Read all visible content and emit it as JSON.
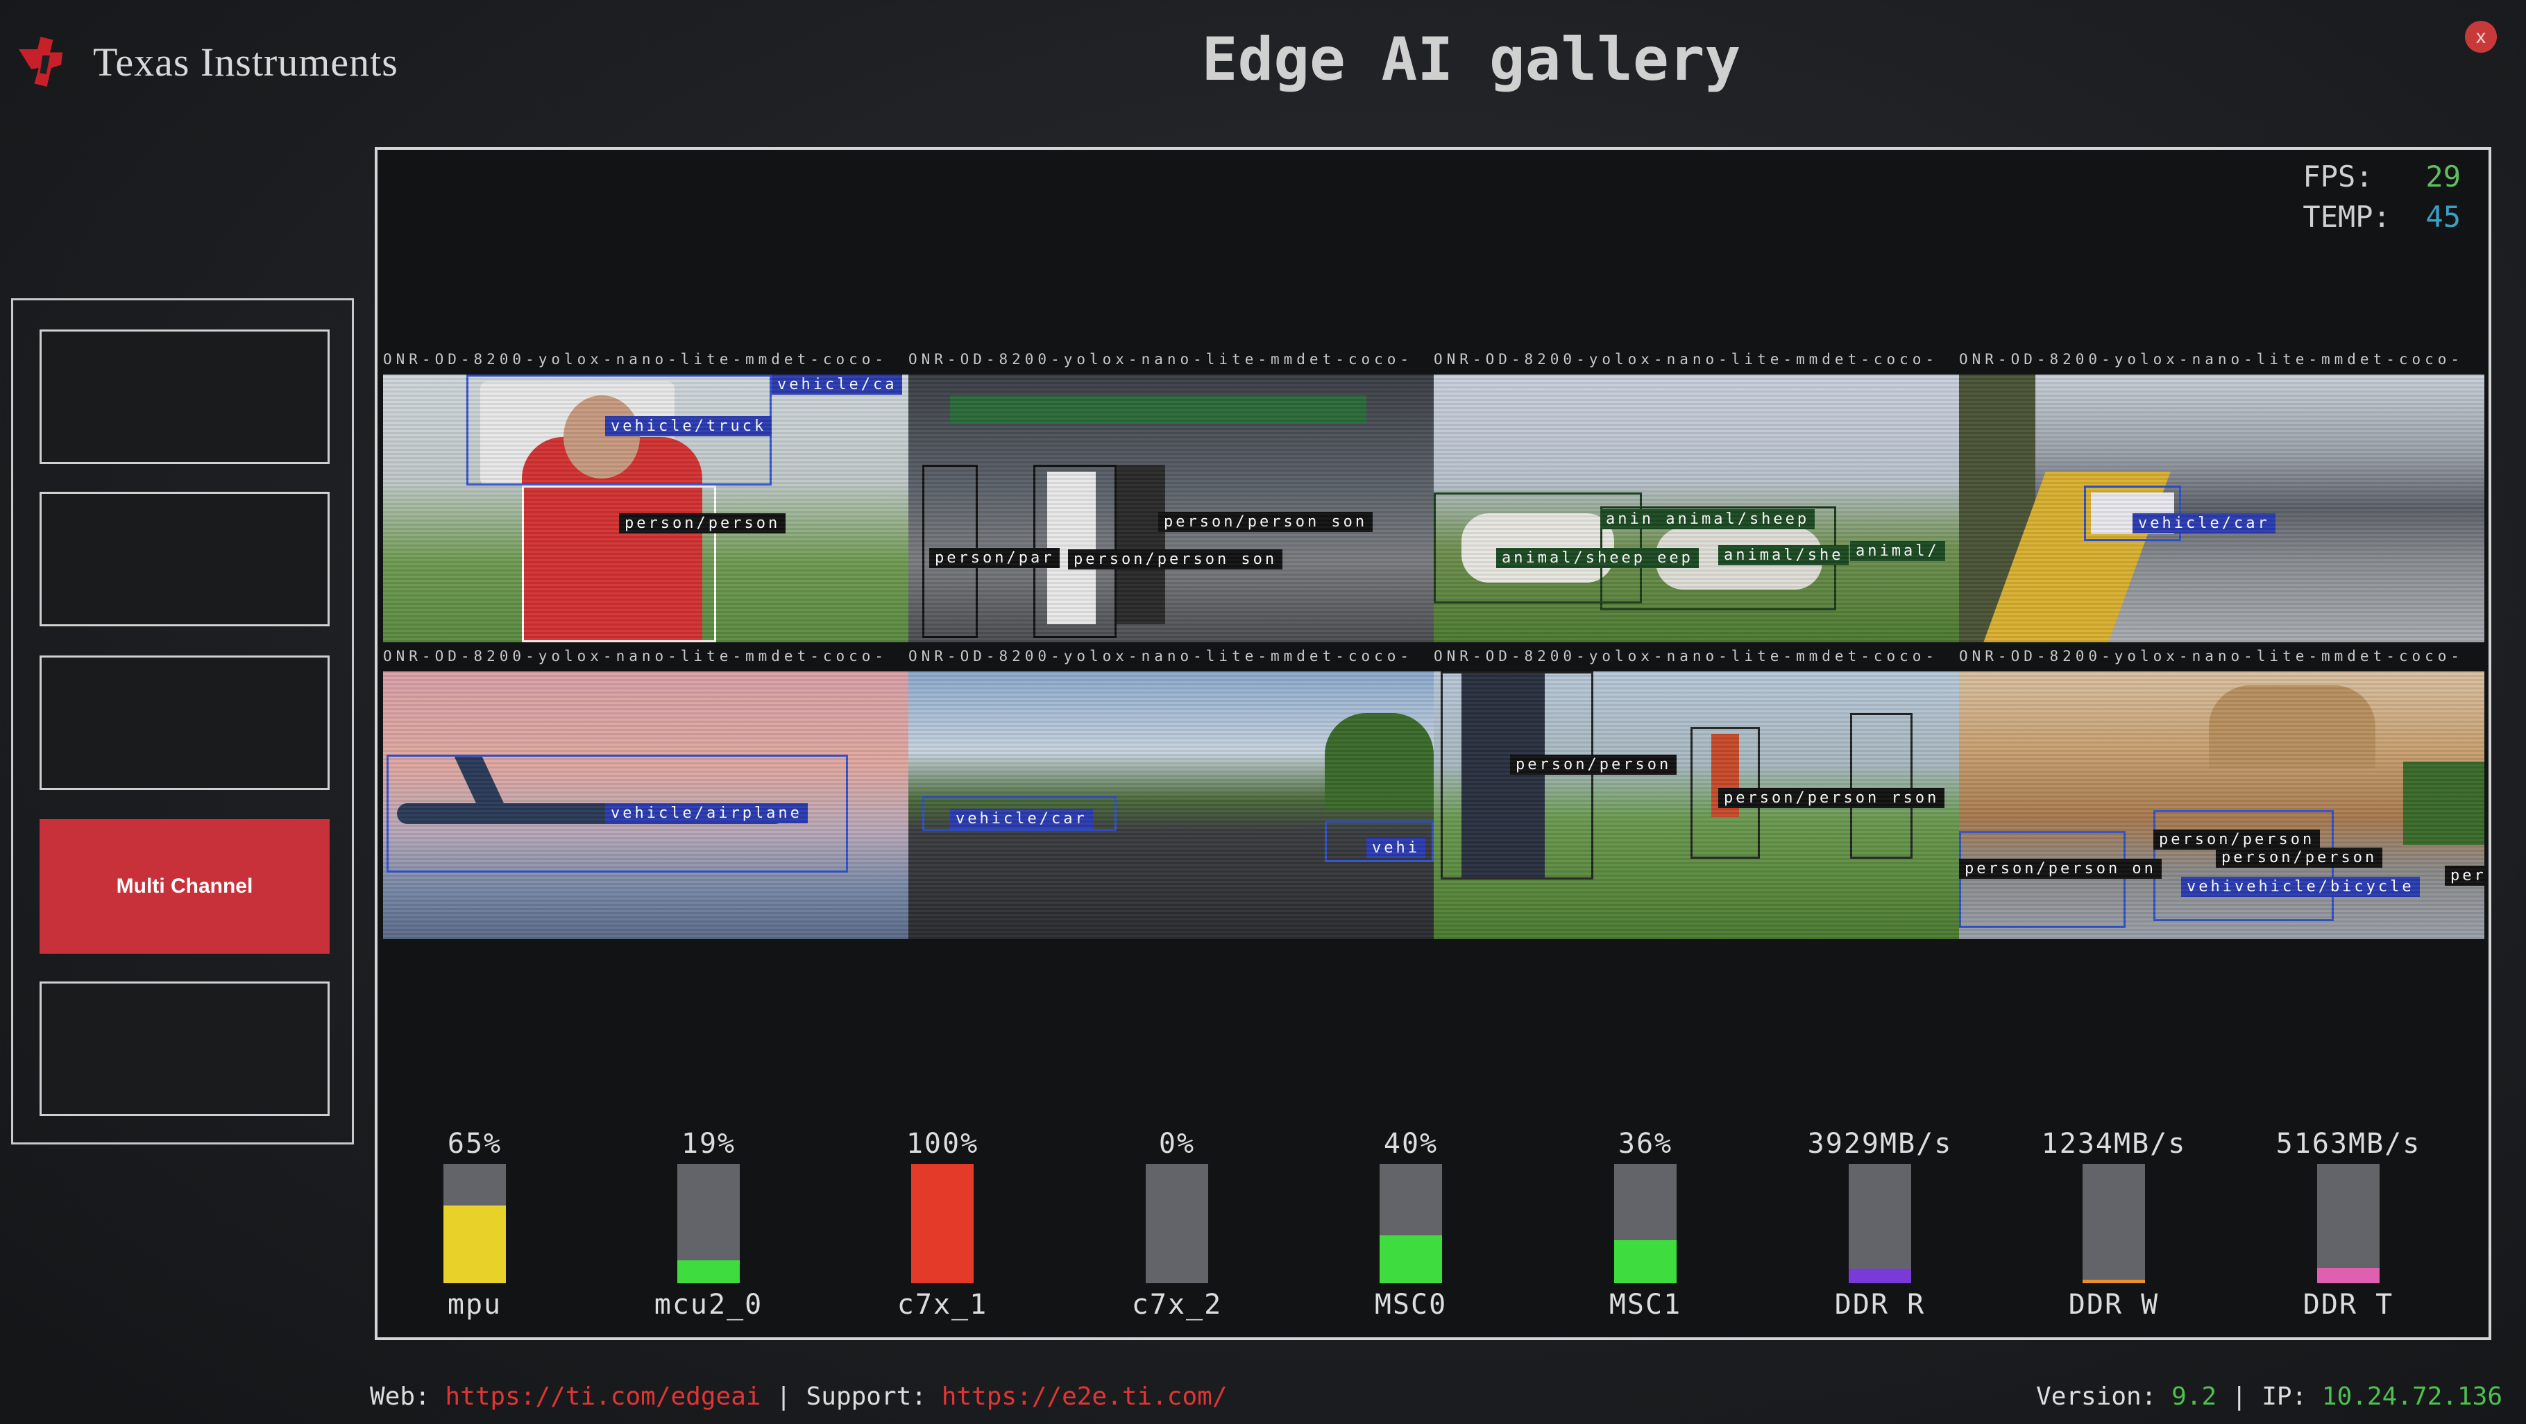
{
  "brand": {
    "name": "Texas Instruments",
    "icon": "ti-logo-icon"
  },
  "title": "Edge AI gallery",
  "close_label": "x",
  "sidebar": {
    "buttons": [
      {
        "label": ""
      },
      {
        "label": ""
      },
      {
        "label": ""
      },
      {
        "label": "Multi Channel",
        "active": true
      },
      {
        "label": ""
      }
    ]
  },
  "stats": {
    "fps_label": "FPS:",
    "fps": "29",
    "temp_label": "TEMP:",
    "temp": "45"
  },
  "channels": [
    {
      "caption": "ONR-OD-8200-yolox-nano-lite-mmdet-coco-",
      "labels": [
        "vehicle/ca",
        "vehicle/truck",
        "person/person"
      ]
    },
    {
      "caption": "ONR-OD-8200-yolox-nano-lite-mmdet-coco-",
      "labels": [
        "person/person son",
        "person/par",
        "person/person son"
      ]
    },
    {
      "caption": "ONR-OD-8200-yolox-nano-lite-mmdet-coco-",
      "labels": [
        "anin animal/sheep",
        "animal/sheep eep",
        "animal/she",
        "animal/"
      ]
    },
    {
      "caption": "ONR-OD-8200-yolox-nano-lite-mmdet-coco-",
      "labels": [
        "vehicle/car"
      ]
    },
    {
      "caption": "ONR-OD-8200-yolox-nano-lite-mmdet-coco-",
      "labels": [
        "vehicle/airplane"
      ]
    },
    {
      "caption": "ONR-OD-8200-yolox-nano-lite-mmdet-coco-",
      "labels": [
        "vehicle/car",
        "vehi"
      ]
    },
    {
      "caption": "ONR-OD-8200-yolox-nano-lite-mmdet-coco-",
      "labels": [
        "person/person",
        "person/person rson"
      ]
    },
    {
      "caption": "ONR-OD-8200-yolox-nano-lite-mmdet-coco-",
      "labels": [
        "person/person",
        "person/person on",
        "person/person",
        "vehivehicle/bicycle",
        "per"
      ]
    }
  ],
  "meters": [
    {
      "value": "65%",
      "name": "mpu",
      "level": 0.65,
      "color": "#e8d22a"
    },
    {
      "value": "19%",
      "name": "mcu2_0",
      "level": 0.19,
      "color": "#3fdc3f"
    },
    {
      "value": "100%",
      "name": "c7x_1",
      "level": 1.0,
      "color": "#e43a2a"
    },
    {
      "value": "0%",
      "name": "c7x_2",
      "level": 0.0,
      "color": "#3fdc3f"
    },
    {
      "value": "40%",
      "name": "MSC0",
      "level": 0.4,
      "color": "#3fdc3f"
    },
    {
      "value": "36%",
      "name": "MSC1",
      "level": 0.36,
      "color": "#3fdc3f"
    },
    {
      "value": "3929MB/s",
      "name": "DDR R",
      "level": 0.12,
      "color": "#7a3ad8"
    },
    {
      "value": "1234MB/s",
      "name": "DDR W",
      "level": 0.03,
      "color": "#e8902a"
    },
    {
      "value": "5163MB/s",
      "name": "DDR T",
      "level": 0.13,
      "color": "#e060b0"
    }
  ],
  "footer": {
    "web_label": "Web:",
    "web_url": "https://ti.com/edgeai",
    "sep": "|",
    "support_label": "Support:",
    "support_url": "https://e2e.ti.com/",
    "version_label": "Version:",
    "version": "9.2",
    "ip_label": "IP:",
    "ip": "10.24.72.136"
  }
}
